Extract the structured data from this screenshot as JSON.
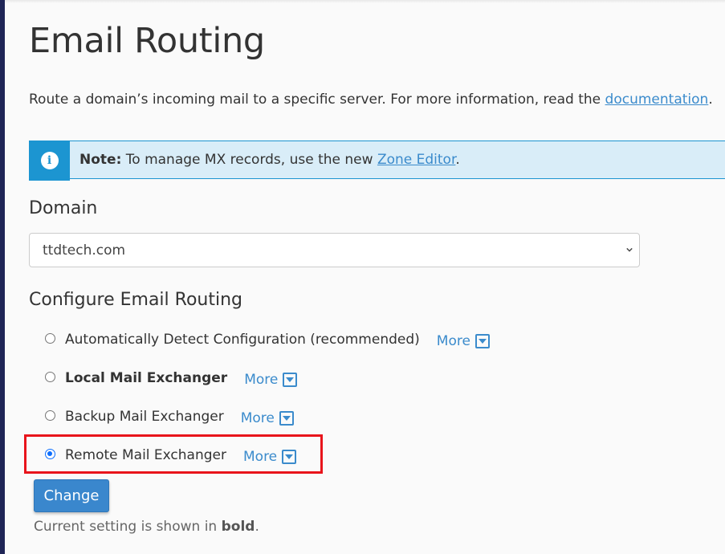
{
  "page": {
    "title": "Email Routing",
    "description_prefix": "Route a domain’s incoming mail to a specific server. For more information, read the ",
    "description_link": "documentation",
    "description_suffix": "."
  },
  "alert": {
    "icon": "info-icon",
    "icon_glyph": "i",
    "label": "Note:",
    "text": " To manage MX records, use the new ",
    "link": "Zone Editor",
    "suffix": ".",
    "colors": {
      "accent": "#1c95d1",
      "background": "#d9edf8"
    }
  },
  "domain": {
    "label": "Domain",
    "selected": "ttdtech.com"
  },
  "routing": {
    "heading": "Configure Email Routing",
    "more_label": "More",
    "options": [
      {
        "label": "Automatically Detect Configuration (recommended)",
        "checked": false,
        "bold": false
      },
      {
        "label": "Local Mail Exchanger",
        "checked": false,
        "bold": true
      },
      {
        "label": "Backup Mail Exchanger",
        "checked": false,
        "bold": false
      },
      {
        "label": "Remote Mail Exchanger",
        "checked": true,
        "bold": false
      }
    ],
    "highlight_color": "#e8141b"
  },
  "actions": {
    "change_label": "Change"
  },
  "hint": {
    "prefix": "Current setting is shown in ",
    "bold": "bold",
    "suffix": "."
  }
}
